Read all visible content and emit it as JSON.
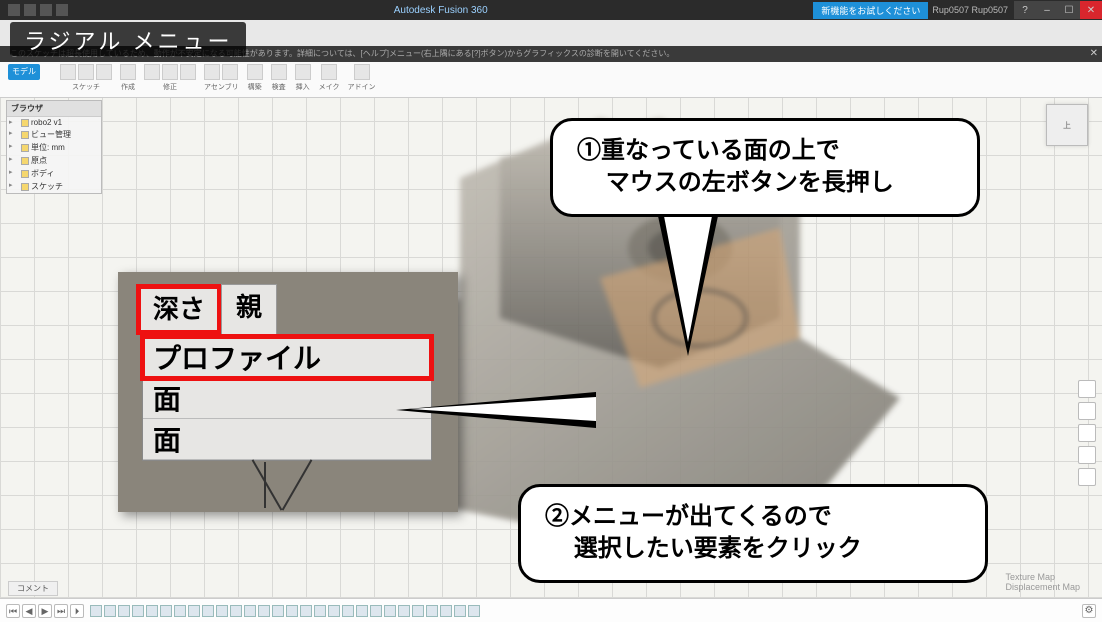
{
  "titlebar": {
    "app_title": "Autodesk Fusion 360",
    "blue_button": "新機能をお試しください",
    "user": "Rup0507 Rup0507",
    "help_icon": "?",
    "min": "–",
    "max": "☐",
    "close": "✕"
  },
  "overlay_heading": "ラジアル メニュー",
  "infobar": {
    "text": "このスケッチは超長使用しているため、動作が不安定になる可能性があります。詳細については、[ヘルプ]メニュー(右上隅にある[?]ボタン)からグラフィックスの診断を開いてください。",
    "close": "✕"
  },
  "ribbon": {
    "mode_tab": "モデル",
    "groups": [
      {
        "label": "スケッチ",
        "icons": 3
      },
      {
        "label": "作成",
        "icons": 1
      },
      {
        "label": "修正",
        "icons": 3
      },
      {
        "label": "アセンブリ",
        "icons": 2
      },
      {
        "label": "構築",
        "icons": 1
      },
      {
        "label": "検査",
        "icons": 1
      },
      {
        "label": "挿入",
        "icons": 1
      },
      {
        "label": "メイク",
        "icons": 1
      },
      {
        "label": "アドイン",
        "icons": 1
      }
    ]
  },
  "navcube": "上",
  "browser": {
    "header": "ブラウザ",
    "root": "robo2 v1",
    "items": [
      "ビュー管理",
      "単位: mm",
      "原点",
      "ボディ",
      "スケッチ"
    ]
  },
  "radial_inset": {
    "tab_depth": "深さ",
    "tab_parent": "親",
    "row_profile": "プロファイル",
    "row_face1": "面",
    "row_face2": "面"
  },
  "callouts": {
    "one_line1": "①重なっている面の上で",
    "one_line2": "マウスの左ボタンを長押し",
    "two_line1": "②メニューが出てくるので",
    "two_line2": "選択したい要素をクリック"
  },
  "timeline": {
    "comment_tab": "コメント",
    "play_buttons": [
      "⏮",
      "◀",
      "▶",
      "⏭",
      "⏵"
    ],
    "feature_count": 28,
    "gear": "⚙"
  },
  "watermark": {
    "l1": "Texture Map",
    "l2": "Displacement Map"
  }
}
